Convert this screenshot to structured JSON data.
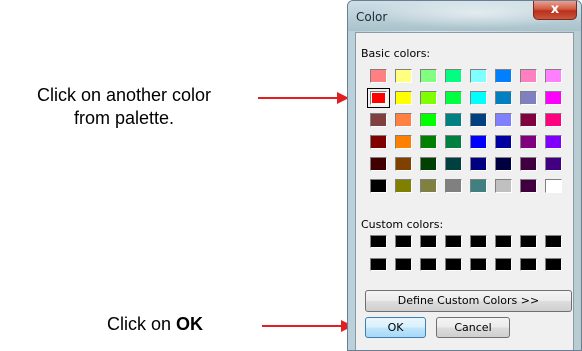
{
  "annotations": {
    "palette_line1": "Click on another color",
    "palette_line2": "from palette.",
    "ok_prefix": "Click on ",
    "ok_bold": "OK",
    "arrow_color": "#e02020"
  },
  "dialog": {
    "title": "Color",
    "close_glyph": "x",
    "basic_colors_label": "Basic colors:",
    "custom_colors_label": "Custom colors:",
    "define_button": "Define Custom Colors >>",
    "ok_button": "OK",
    "cancel_button": "Cancel",
    "selected_index": 8,
    "basic_colors": [
      "#ff8080",
      "#ffff80",
      "#80ff80",
      "#00ff80",
      "#80ffff",
      "#0080ff",
      "#ff80c0",
      "#ff80ff",
      "#ff0000",
      "#ffff00",
      "#80ff00",
      "#00ff40",
      "#00ffff",
      "#0080c0",
      "#8080c0",
      "#ff00ff",
      "#804040",
      "#ff8040",
      "#00ff00",
      "#008080",
      "#004080",
      "#8080ff",
      "#800040",
      "#ff0080",
      "#800000",
      "#ff8000",
      "#008000",
      "#008040",
      "#0000ff",
      "#0000a0",
      "#800080",
      "#8000ff",
      "#400000",
      "#804000",
      "#004000",
      "#004040",
      "#000080",
      "#000040",
      "#400040",
      "#400080",
      "#000000",
      "#808000",
      "#808040",
      "#808080",
      "#408080",
      "#c0c0c0",
      "#400040",
      "#ffffff"
    ],
    "custom_colors": [
      "#000000",
      "#000000",
      "#000000",
      "#000000",
      "#000000",
      "#000000",
      "#000000",
      "#000000",
      "#000000",
      "#000000",
      "#000000",
      "#000000",
      "#000000",
      "#000000",
      "#000000",
      "#000000"
    ]
  }
}
